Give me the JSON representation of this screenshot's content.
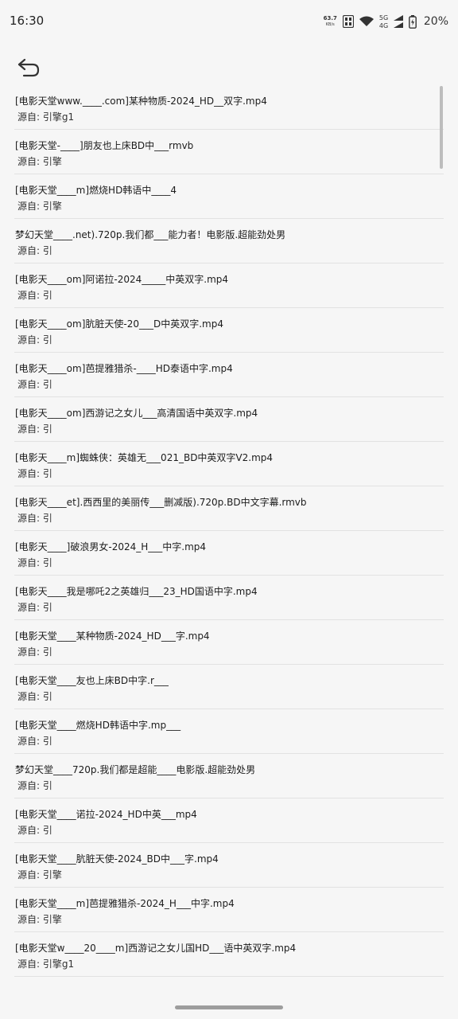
{
  "status_bar": {
    "time": "16:30",
    "net_speed_value": "63.7",
    "net_speed_unit": "KB/s",
    "signal_label_top": "5G",
    "signal_label_bottom": "4G",
    "battery_percent": "20%"
  },
  "header": {
    "back_icon": "back-arrow-icon"
  },
  "file_list": {
    "items": [
      {
        "title": "[电影天堂www.____.com]某种物质-2024_HD__双字.mp4",
        "source": "源自: 引擎g1"
      },
      {
        "title": "[电影天堂-____]朋友也上床BD中___rmvb",
        "source": "源自: 引擎"
      },
      {
        "title": "[电影天堂____m]燃烧HD韩语中____4",
        "source": "源自: 引擎"
      },
      {
        "title": "梦幻天堂____.net).720p.我们都___能力者！电影版.超能劲处男",
        "source": "源自: 引"
      },
      {
        "title": "[电影天____om]阿诺拉-2024_____中英双字.mp4",
        "source": "源自: 引"
      },
      {
        "title": "[电影天____om]肮脏天使-20___D中英双字.mp4",
        "source": "源自: 引"
      },
      {
        "title": "[电影天____om]芭提雅猎杀-____HD泰语中字.mp4",
        "source": "源自: 引"
      },
      {
        "title": "[电影天____om]西游记之女儿___高清国语中英双字.mp4",
        "source": "源自: 引"
      },
      {
        "title": "[电影天____m]蜘蛛侠：英雄无___021_BD中英双字V2.mp4",
        "source": "源自: 引"
      },
      {
        "title": "[电影天____et].西西里的美丽传___删减版).720p.BD中文字幕.rmvb",
        "source": "源自: 引"
      },
      {
        "title": "[电影天____]破浪男女-2024_H___中字.mp4",
        "source": "源自: 引"
      },
      {
        "title": "[电影天____我是哪吒2之英雄归___23_HD国语中字.mp4",
        "source": "源自: 引"
      },
      {
        "title": "[电影天堂____某种物质-2024_HD___字.mp4",
        "source": "源自: 引"
      },
      {
        "title": "[电影天堂____友也上床BD中字.r___",
        "source": "源自: 引"
      },
      {
        "title": "[电影天堂____燃烧HD韩语中字.mp___",
        "source": "源自: 引"
      },
      {
        "title": "梦幻天堂____720p.我们都是超能____电影版.超能劲处男",
        "source": "源自: 引"
      },
      {
        "title": "[电影天堂____诺拉-2024_HD中英___mp4",
        "source": "源自: 引"
      },
      {
        "title": "[电影天堂____肮脏天使-2024_BD中___字.mp4",
        "source": "源自: 引擎"
      },
      {
        "title": "[电影天堂____m]芭提雅猎杀-2024_H___中字.mp4",
        "source": "源自: 引擎"
      },
      {
        "title": "[电影天堂w____20____m]西游记之女儿国HD___语中英双字.mp4",
        "source": "源自: 引擎g1"
      }
    ]
  }
}
